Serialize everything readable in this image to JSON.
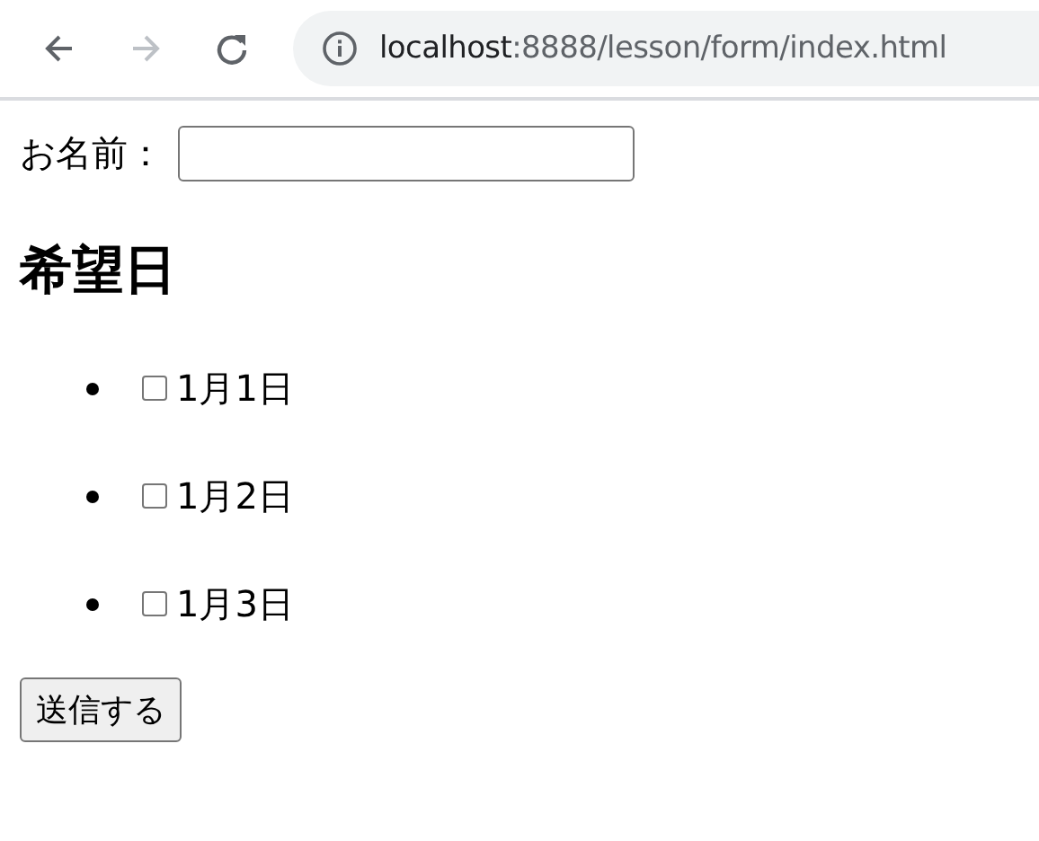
{
  "browser": {
    "url_host": "localhost",
    "url_path": ":8888/lesson/form/index.html",
    "forward_disabled": true
  },
  "form": {
    "name_label": "お名前：",
    "heading": "希望日",
    "dates": [
      {
        "label": "1月1日",
        "checked": false
      },
      {
        "label": "1月2日",
        "checked": false
      },
      {
        "label": "1月3日",
        "checked": false
      }
    ],
    "submit": "送信する"
  }
}
